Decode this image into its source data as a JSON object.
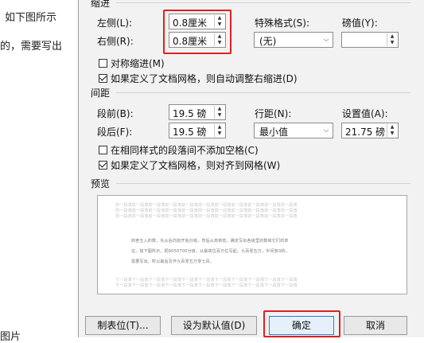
{
  "background": {
    "text1": "如下图所示",
    "text2": "的，需要写出",
    "text3": "图片"
  },
  "indent": {
    "title": "缩进",
    "left_label": "左侧(L):",
    "left_value": "0.8厘米",
    "right_label": "右侧(R):",
    "right_value": "0.8厘米",
    "special_label": "特殊格式(S):",
    "special_value": "(无)",
    "by_label": "磅值(Y):",
    "by_value": "",
    "mirror_label": "对称缩进(M)",
    "mirror_checked": false,
    "auto_right_label": "如果定义了文档网格，则自动调整右缩进(D)",
    "auto_right_checked": true
  },
  "spacing": {
    "title": "间距",
    "before_label": "段前(B):",
    "before_value": "19.5 磅",
    "after_label": "段后(F):",
    "after_value": "19.5 磅",
    "line_label": "行距(N):",
    "line_value": "最小值",
    "at_label": "设置值(A):",
    "at_value": "21.75 磅",
    "no_space_label": "在相同样式的段落间不添加空格(C)",
    "no_space_checked": false,
    "snap_grid_label": "如果定义了文档网格，则对齐到网格(W)",
    "snap_grid_checked": true
  },
  "preview": {
    "title": "预览",
    "prev_line": "前一段落前一段落前一段落前一段落前一段落前一段落前一段落前一段落前一段落前一段落前一段落",
    "sample_1": "四舍五入的数，先从后向前开始分级，然后从高到低，确定写出各级里的数和它们的单",
    "sample_2": "位。如下图所示，把9050700分级，从最高位百万位写起。九百零五万，中间有0的，",
    "sample_3": "需要写出，所以最后写作九百零五万零七百。",
    "next_line": "下一段落下一段落下一段落下一段落下一段落下一段落下一段落下一段落下一段落下一段落下一段落"
  },
  "buttons": {
    "tabs": "制表位(T)...",
    "set_default": "设为默认值(D)",
    "ok": "确定",
    "cancel": "取消"
  },
  "colors": {
    "highlight": "#e02020",
    "dialog_bg": "#f2f2f2",
    "primary_border": "#2d7dd6"
  }
}
